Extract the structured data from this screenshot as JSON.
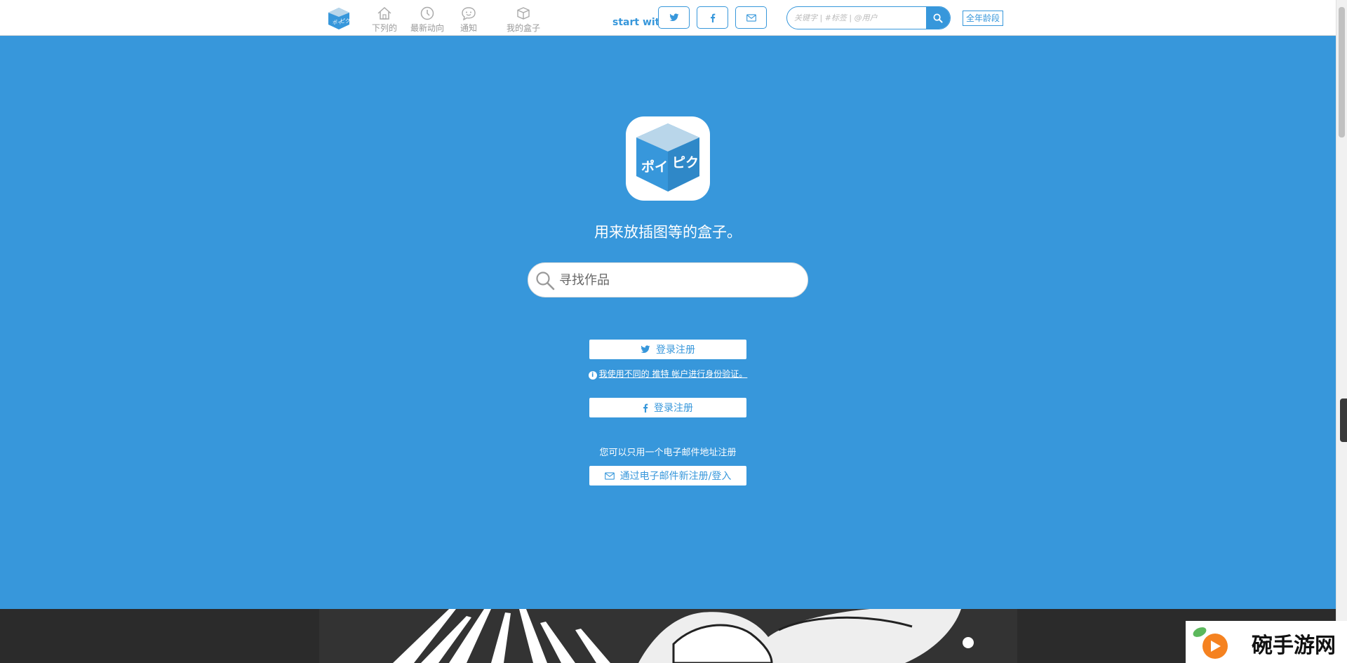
{
  "header": {
    "nav": [
      {
        "label": "下列的",
        "icon": "home-icon"
      },
      {
        "label": "最新动向",
        "icon": "clock-icon"
      },
      {
        "label": "通知",
        "icon": "chat-icon"
      },
      {
        "label": "我的盒子",
        "icon": "box-icon"
      }
    ],
    "start_with": "start with",
    "social": [
      "twitter-icon",
      "facebook-icon",
      "mail-icon"
    ],
    "search_placeholder": "关键字 | #标签 | @用户",
    "age_badge": "全年龄段"
  },
  "main": {
    "logo_text": "ポイピク",
    "tagline": "用来放插图等的盒子。",
    "search_placeholder": "寻找作品",
    "twitter_login": "登录注册",
    "twitter_note": "我使用不同的 推特 帐户进行身份验证。",
    "facebook_login": "登录注册",
    "email_note": "您可以只用一个电子邮件地址注册",
    "email_login": "通过电子邮件新注册/登入"
  },
  "watermark": "碗手游网",
  "colors": {
    "accent": "#3797db",
    "header_bg": "#ffffff",
    "footer_bg": "#2b2b2b"
  }
}
